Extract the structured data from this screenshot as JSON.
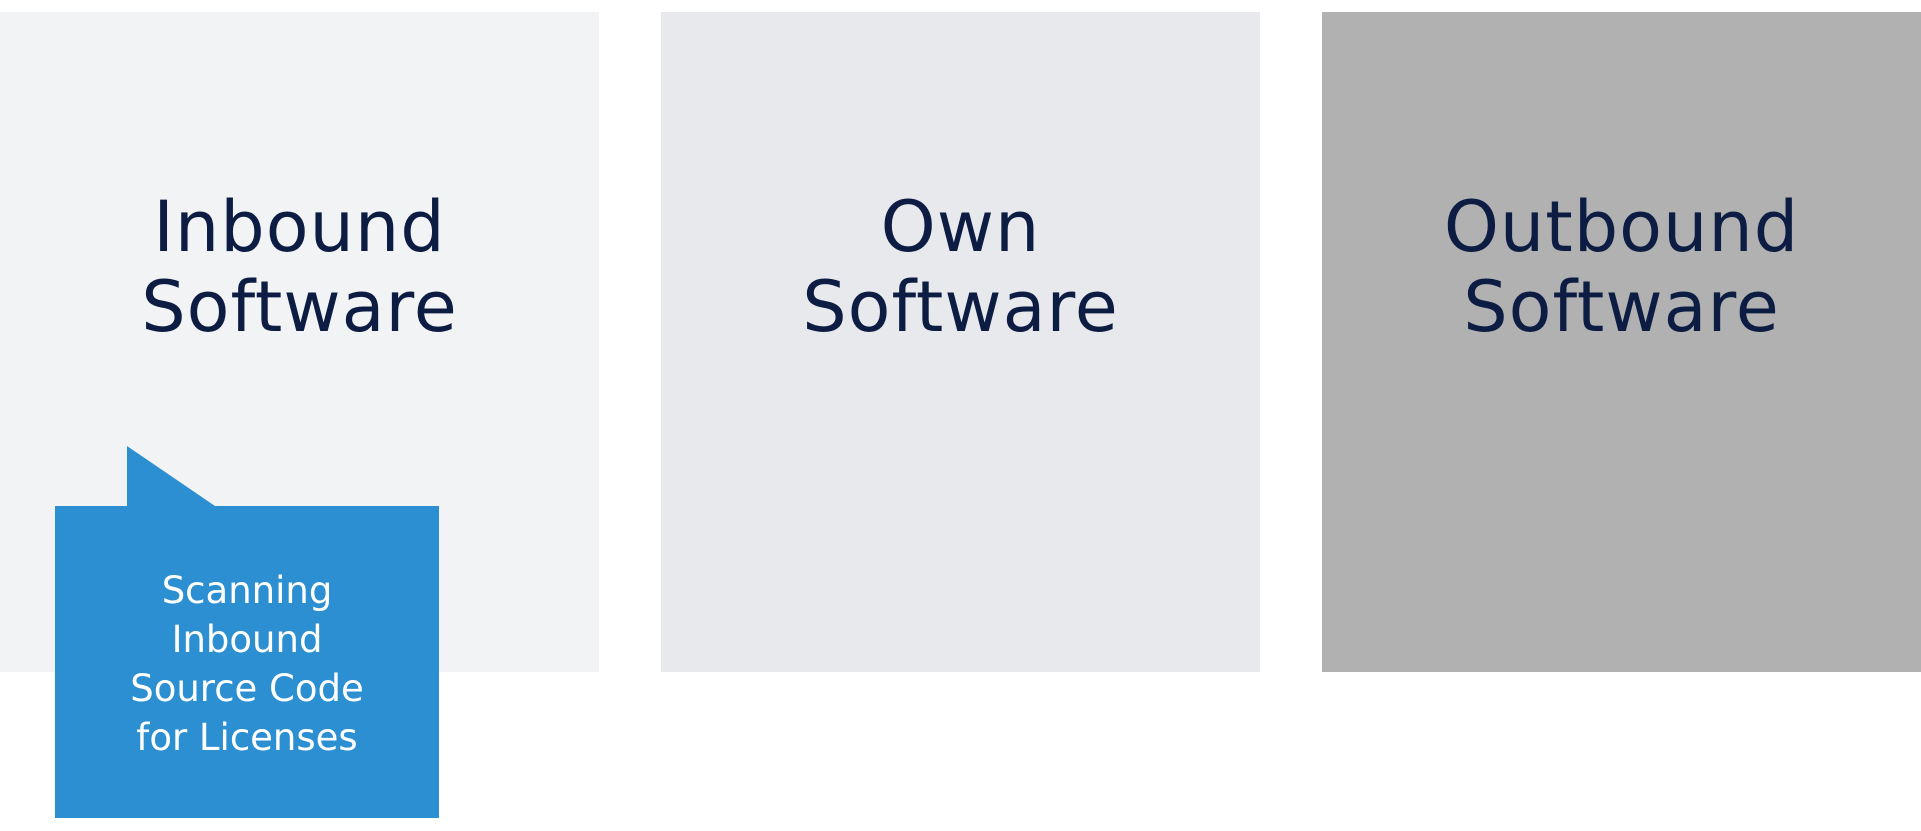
{
  "panels": [
    {
      "id": "inbound",
      "title": "Inbound\nSoftware",
      "background": "#f2f3f5"
    },
    {
      "id": "own",
      "title": "Own\nSoftware",
      "background": "#e8e9ed"
    },
    {
      "id": "outbound",
      "title": "Outbound\nSoftware",
      "background": "#b1b1b1"
    }
  ],
  "callout": {
    "text": "Scanning\nInbound\nSource Code\nfor Licenses",
    "color": "#2b8fd1",
    "text_color": "#ffffff"
  },
  "colors": {
    "title_text": "#0c1c42",
    "page_background": "#ffffff"
  }
}
